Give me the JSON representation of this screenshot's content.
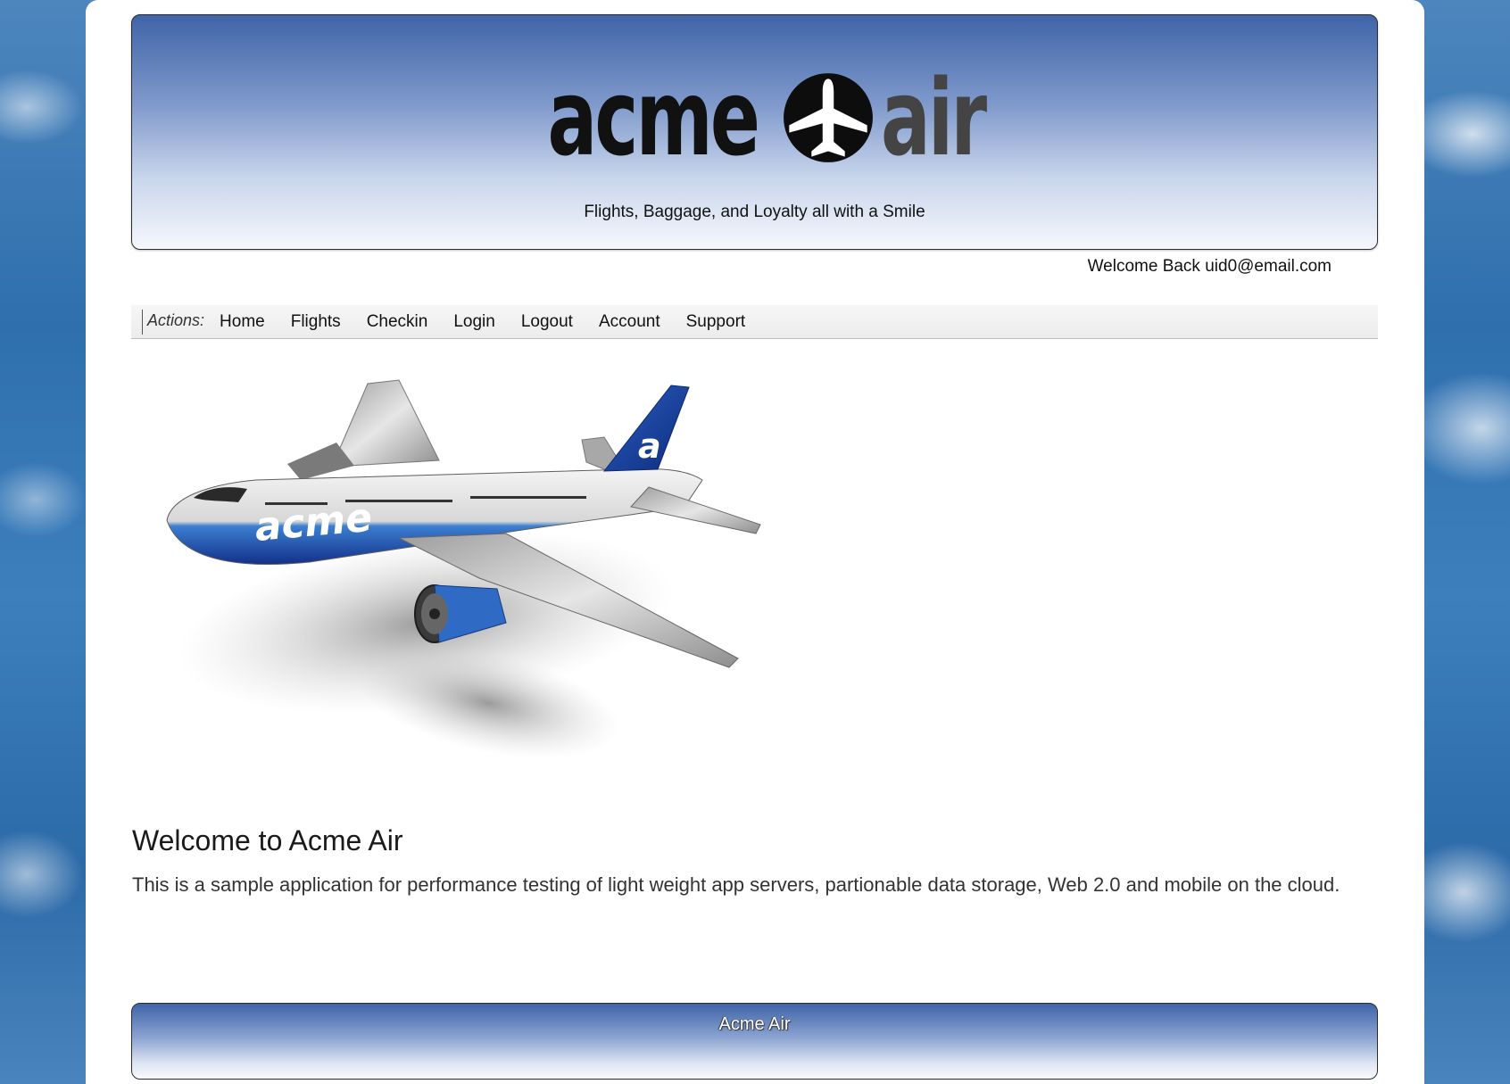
{
  "header": {
    "logo_text_left": "acme",
    "logo_text_right": "air",
    "logo_icon": "airplane-circle-icon",
    "tagline": "Flights, Baggage, and Loyalty all with a Smile"
  },
  "user": {
    "welcome": "Welcome Back uid0@email.com"
  },
  "nav": {
    "label": "Actions:",
    "links": [
      "Home",
      "Flights",
      "Checkin",
      "Login",
      "Logout",
      "Account",
      "Support"
    ]
  },
  "hero": {
    "image": "acme-airplane-illustration",
    "fuselage_text": "acme",
    "tail_text": "a"
  },
  "main": {
    "title": "Welcome to Acme Air",
    "description": "This is a sample application for performance testing of light weight app servers, partionable data storage, Web 2.0 and mobile on the cloud."
  },
  "footer": {
    "text": "Acme Air"
  },
  "colors": {
    "header_top": "#3f64a8",
    "header_bottom": "#f5f7fc",
    "sky": "#2f6fae",
    "plane_blue": "#1f4fa8"
  }
}
